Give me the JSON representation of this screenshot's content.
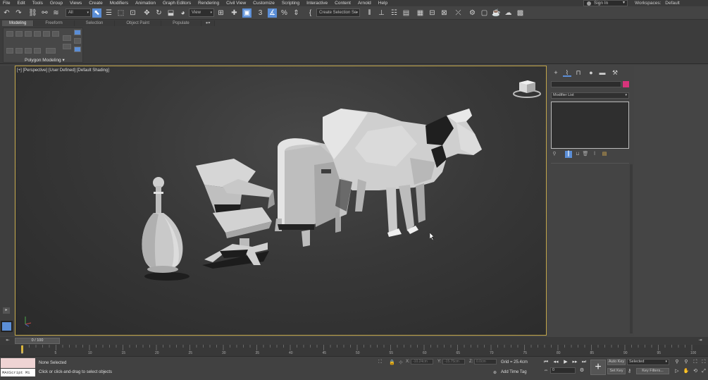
{
  "menu": [
    "File",
    "Edit",
    "Tools",
    "Group",
    "Views",
    "Create",
    "Modifiers",
    "Animation",
    "Graph Editors",
    "Rendering",
    "Civil View",
    "Customize",
    "Scripting",
    "Interactive",
    "Content",
    "Arnold",
    "Help"
  ],
  "account": {
    "signin_label": "Sign In",
    "workspaces_label": "Workspaces:",
    "workspace_value": "Default"
  },
  "toolbar": {
    "selection_filter": "All",
    "reference_coord": "View",
    "named_selection": "Create Selection Se"
  },
  "ribbon": {
    "tabs": [
      "Modeling",
      "Freeform",
      "Selection",
      "Object Paint",
      "Populate"
    ],
    "panel_label": "Polygon Modeling ▾"
  },
  "viewport": {
    "label": "[+] [Perspective] [User Defined] [Default Shading]"
  },
  "command_panel": {
    "modifier_list": "Modifier List",
    "accent_color": "#d7347b"
  },
  "timeline": {
    "range_label": "0 / 100",
    "ticks": [
      "0",
      "5",
      "10",
      "15",
      "20",
      "25",
      "30",
      "35",
      "40",
      "45",
      "50",
      "55",
      "60",
      "65",
      "70",
      "75",
      "80",
      "85",
      "90",
      "95",
      "100"
    ]
  },
  "status": {
    "maxscript_label": "MAXScript Mi",
    "selection": "None Selected",
    "prompt": "Click or click-and-drag to select objects",
    "x_label": "X:",
    "y_label": "Y:",
    "z_label": "Z:",
    "x_value": "-10.24cm",
    "y_value": "-15.75cm",
    "z_value": "0.0cm",
    "grid": "Grid = 25.4cm",
    "add_time_tag": "Add Time Tag",
    "frame": "0",
    "auto_key": "Auto Key",
    "set_key": "Set Key",
    "selected": "Selected",
    "key_filters": "Key Filters..."
  }
}
